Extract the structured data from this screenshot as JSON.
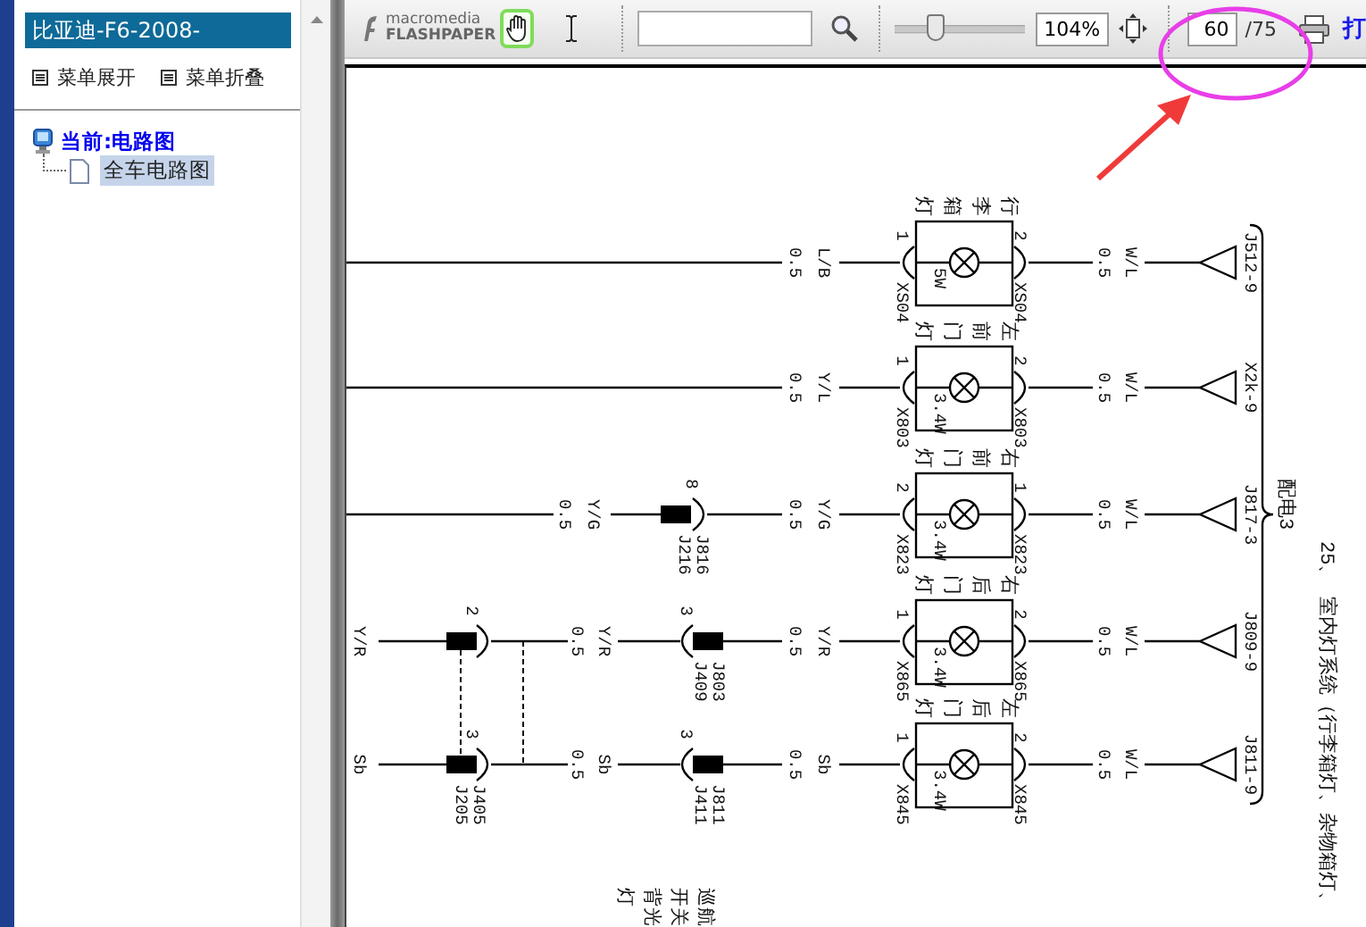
{
  "sidebar": {
    "title": "比亚迪-F6-2008-",
    "menu": [
      {
        "label": "菜单展开"
      },
      {
        "label": "菜单折叠"
      }
    ],
    "tree": [
      {
        "label": "当前:电路图",
        "selected": false,
        "children": [
          {
            "label": "全车电路图",
            "selected": true
          }
        ]
      }
    ]
  },
  "toolbar": {
    "logo": {
      "line_1": "macromedia",
      "line_2": "FLASHPAPER"
    },
    "tools": [
      {
        "kind": "hand",
        "selected": true
      },
      {
        "kind": "text",
        "selected": false
      }
    ],
    "zoom": {
      "level": 0.32,
      "reading": "104%"
    },
    "page": {
      "current": "60",
      "total": "/75"
    },
    "print_label": "打"
  },
  "diagram": {
    "title": "25、 室内灯系统（行李箱灯、杂物箱灯、",
    "bus_label": "配电3",
    "switch_label": "巡航开关背光灯",
    "rows": [
      {
        "name": "行李箱灯",
        "power": "5W",
        "pins": [
          "1",
          "2"
        ],
        "codes": [
          "XS04",
          "XS04"
        ],
        "in_wire": {
          "marking": "L/B",
          "size": "0.5"
        },
        "out_wire": {
          "marking": "W/L",
          "size": "0.5"
        },
        "terminal": "J512-9"
      },
      {
        "name": "左前门灯",
        "power": "3.4W",
        "pins": [
          "1",
          "2"
        ],
        "codes": [
          "X803",
          "X803"
        ],
        "in_wire": {
          "marking": "Y/L",
          "size": "0.5"
        },
        "out_wire": {
          "marking": "W/L",
          "size": "0.5"
        },
        "terminal": "X2k-9"
      },
      {
        "name": "右前门灯",
        "power": "3.4W",
        "pins": [
          "2",
          "1"
        ],
        "codes": [
          "X823",
          "X823"
        ],
        "in_wire": {
          "marking": "Y/G",
          "size": "0.5"
        },
        "out_wire": {
          "marking": "W/L",
          "size": "0.5"
        },
        "terminal": "J817-3",
        "upstream": {
          "kind": "plug_socket",
          "pin": "8",
          "codes": [
            "J816",
            "J216"
          ],
          "wire": {
            "marking": "Y/G",
            "size": "0.5"
          }
        }
      },
      {
        "name": "右后门灯",
        "power": "3.4W",
        "pins": [
          "1",
          "2"
        ],
        "codes": [
          "X865",
          "X865"
        ],
        "in_wire": {
          "marking": "Y/R",
          "size": "0.5"
        },
        "out_wire": {
          "marking": "W/L",
          "size": "0.5"
        },
        "terminal": "J809-9",
        "upstream": {
          "kind": "socket_plug",
          "pin": "3",
          "codes": [
            "J803",
            "J409"
          ],
          "wire": {
            "marking": "Y/R",
            "size": "0.5"
          }
        },
        "source": {
          "label": "Y/R",
          "pin": "2"
        }
      },
      {
        "name": "左后门灯",
        "power": "3.4W",
        "pins": [
          "1",
          "2"
        ],
        "codes": [
          "X845",
          "X845"
        ],
        "in_wire": {
          "marking": "Sb",
          "size": "0.5"
        },
        "out_wire": {
          "marking": "W/L",
          "size": "0.5"
        },
        "terminal": "J811-9",
        "upstream": {
          "kind": "socket_plug",
          "pin": "3",
          "codes": [
            "J811",
            "J411"
          ],
          "wire": {
            "marking": "Sb",
            "size": "0.5"
          }
        },
        "source": {
          "label": "Sb",
          "pin": "3",
          "codes": [
            "J405",
            "J205"
          ]
        }
      }
    ]
  }
}
